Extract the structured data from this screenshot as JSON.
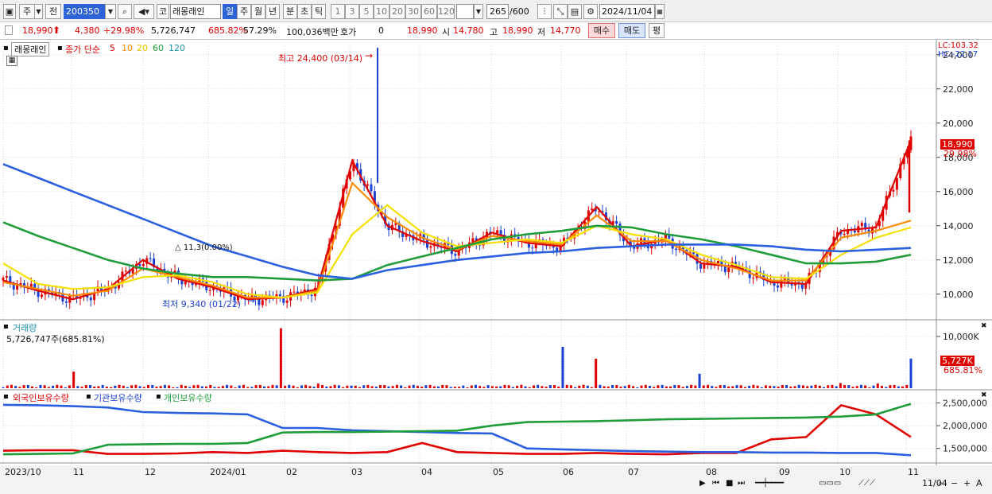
{
  "toolbar": {
    "period_label": "주",
    "prev_label": "전",
    "code": "200350",
    "market_label": "코",
    "stock_name": "래몽래인",
    "tabs": [
      "일",
      "주",
      "월",
      "년",
      "분",
      "초",
      "틱"
    ],
    "active_tab": "일",
    "intervals": [
      "1",
      "3",
      "5",
      "10",
      "20",
      "30",
      "60",
      "120"
    ],
    "count": "265",
    "count_total": "/600",
    "date": "2024/11/04"
  },
  "quote": {
    "price": "18,990",
    "change": "4,380",
    "change_pct": "+29.98%",
    "volume": "5,726,747",
    "volume_ratio": "685.82%",
    "turnover_pct": "57.29%",
    "amount": "100,036백만",
    "hoga_label": "호가",
    "hoga_value": "0",
    "hoga_price": "18,990",
    "open_label": "시",
    "open": "14,780",
    "high_label": "고",
    "high": "18,990",
    "low_label": "저",
    "low": "14,770",
    "buy_label": "매수",
    "sell_label": "매도",
    "flat_label": "평"
  },
  "price_panel": {
    "stock_name": "래몽래인",
    "ma_label": "종가 단순",
    "ma_periods": [
      "5",
      "10",
      "20",
      "60",
      "120"
    ],
    "ma_colors": [
      "#e00000",
      "#ff8c00",
      "#f5e000",
      "#1f9d3b",
      "#2a5fe0"
    ],
    "lc_label": "LC:103.32",
    "hc_label": "HC:-22.17",
    "high_annotation": "최고 24,400 (03/14)",
    "low_annotation": "최저 9,340 (01/22)",
    "mid_annotation": "△ 11,3(0.00%)",
    "last_price_tag": "18,990",
    "last_pct_tag": "29.98%"
  },
  "volume_panel": {
    "title": "거래량",
    "value": "5,726,747주(685.81%)",
    "last_tag": "5,727K",
    "last_pct_tag": "685.81%"
  },
  "holdings_panel": {
    "series": [
      "외국인보유수량",
      "기관보유수량",
      "개인보유수량"
    ],
    "series_colors": [
      "#e00000",
      "#2a5fe0",
      "#1f9d3b"
    ]
  },
  "xaxis": [
    "2023/10",
    "11",
    "12",
    "2024/01",
    "02",
    "03",
    "04",
    "05",
    "06",
    "07",
    "08",
    "09",
    "10",
    "11"
  ],
  "xaxis_right": "11/04",
  "chart_data": [
    {
      "type": "line",
      "title": "",
      "subtitle": "candlestick price chart with moving averages (closing price)",
      "yaxis_ticks": [
        "10,000",
        "12,000",
        "14,000",
        "16,000",
        "18,000",
        "20,000",
        "22,000",
        "24,000"
      ],
      "ylim": [
        8500,
        24500
      ],
      "x": [
        "2023/10",
        "11",
        "12",
        "2024/01",
        "02",
        "03",
        "04",
        "05",
        "06",
        "07",
        "08",
        "09",
        "10",
        "11"
      ],
      "series": [
        {
          "name": "5",
          "values": [
            10800,
            10200,
            9700,
            10300,
            12000,
            10900,
            10400,
            9700,
            9800,
            10300,
            17800,
            14000,
            13100,
            12500,
            13600,
            13000,
            12800,
            15100,
            12800,
            13200,
            11800,
            11600,
            10700,
            10600,
            13700,
            13900,
            18990
          ]
        },
        {
          "name": "10",
          "values": [
            10700,
            10300,
            9900,
            10200,
            11500,
            11000,
            10500,
            9800,
            9800,
            10200,
            16500,
            14500,
            13300,
            12600,
            13400,
            13100,
            12900,
            14600,
            13100,
            13100,
            12000,
            11500,
            10800,
            10800,
            13300,
            13700,
            14300
          ]
        },
        {
          "name": "20",
          "values": [
            11800,
            10600,
            10300,
            10400,
            11000,
            11100,
            10700,
            10000,
            9800,
            10100,
            13500,
            15200,
            13600,
            12800,
            13000,
            13200,
            13000,
            14000,
            13500,
            13200,
            12300,
            11700,
            11000,
            10900,
            12300,
            13300,
            13900
          ]
        },
        {
          "name": "60",
          "values": [
            14200,
            13400,
            12700,
            12000,
            11500,
            11200,
            11000,
            11000,
            10900,
            10800,
            10900,
            11700,
            12200,
            12700,
            13200,
            13500,
            13700,
            14000,
            13900,
            13500,
            13200,
            12800,
            12300,
            11800,
            11800,
            11900,
            12300
          ]
        },
        {
          "name": "120",
          "values": [
            17600,
            16800,
            16000,
            15200,
            14400,
            13600,
            12800,
            12200,
            11600,
            11100,
            10900,
            11400,
            11700,
            12000,
            12200,
            12400,
            12500,
            12700,
            12800,
            12900,
            12900,
            12900,
            12800,
            12600,
            12500,
            12600,
            12700
          ]
        }
      ],
      "annotations": [
        "최고 24,400 (03/14)",
        "최저 9,340 (01/22)"
      ]
    },
    {
      "type": "bar",
      "title": "거래량",
      "yaxis_ticks": [
        "10,000K"
      ],
      "ylim": [
        0,
        12000
      ],
      "x": [
        "2023/10",
        "11",
        "12",
        "2024/01",
        "02",
        "03",
        "04",
        "05",
        "06",
        "07",
        "08",
        "09",
        "10",
        "11"
      ],
      "series": [
        {
          "name": "거래량",
          "values": [
            200,
            180,
            3200,
            300,
            250,
            200,
            260,
            220,
            11600,
            900,
            500,
            350,
            300,
            280,
            400,
            350,
            8000,
            5700,
            400,
            350,
            2800,
            600,
            450,
            400,
            1000,
            900,
            5727
          ]
        }
      ]
    },
    {
      "type": "line",
      "title": "",
      "subtitle": "holdings by investor type",
      "yaxis_ticks": [
        "1,500,000",
        "2,000,000",
        "2,500,000"
      ],
      "ylim": [
        1250000,
        2650000
      ],
      "x": [
        "2023/10",
        "11",
        "12",
        "2024/01",
        "02",
        "03",
        "04",
        "05",
        "06",
        "07",
        "08",
        "09",
        "10",
        "11"
      ],
      "series": [
        {
          "name": "외국인보유수량",
          "values": [
            1450000,
            1460000,
            1460000,
            1380000,
            1380000,
            1390000,
            1420000,
            1400000,
            1450000,
            1420000,
            1400000,
            1420000,
            1620000,
            1420000,
            1400000,
            1380000,
            1380000,
            1400000,
            1380000,
            1370000,
            1400000,
            1400000,
            1700000,
            1750000,
            2450000,
            2250000,
            1750000
          ]
        },
        {
          "name": "기관보유수량",
          "values": [
            2460000,
            2450000,
            2430000,
            2400000,
            2300000,
            2280000,
            2270000,
            2250000,
            1950000,
            1950000,
            1900000,
            1880000,
            1860000,
            1840000,
            1830000,
            1500000,
            1480000,
            1460000,
            1440000,
            1430000,
            1420000,
            1420000,
            1410000,
            1410000,
            1400000,
            1400000,
            1350000
          ]
        },
        {
          "name": "개인보유수량",
          "values": [
            1370000,
            1380000,
            1390000,
            1580000,
            1590000,
            1600000,
            1600000,
            1620000,
            1850000,
            1860000,
            1860000,
            1870000,
            1880000,
            1890000,
            2000000,
            2080000,
            2090000,
            2100000,
            2120000,
            2140000,
            2150000,
            2160000,
            2170000,
            2180000,
            2200000,
            2250000,
            2480000
          ]
        }
      ]
    }
  ]
}
